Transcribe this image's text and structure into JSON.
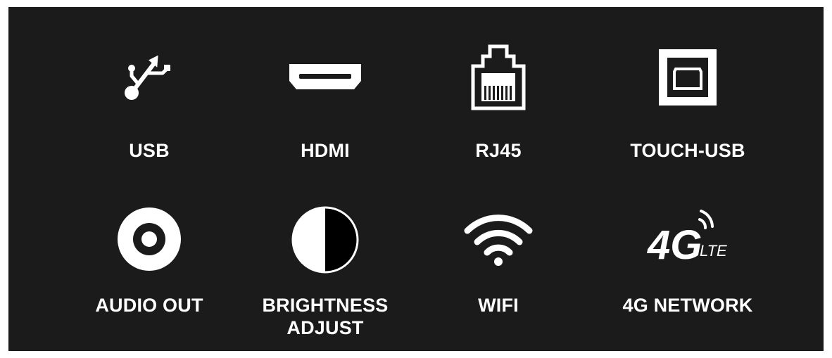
{
  "features": [
    {
      "label": "USB",
      "icon": "usb-icon"
    },
    {
      "label": "HDMI",
      "icon": "hdmi-port-icon"
    },
    {
      "label": "RJ45",
      "icon": "ethernet-port-icon"
    },
    {
      "label": "TOUCH-USB",
      "icon": "usb-b-port-icon"
    },
    {
      "label": "AUDIO OUT",
      "icon": "audio-jack-icon"
    },
    {
      "label": "BRIGHTNESS\nADJUST",
      "icon": "brightness-half-circle-icon"
    },
    {
      "label": "WIFI",
      "icon": "wifi-icon"
    },
    {
      "label": "4G NETWORK",
      "icon": "4g-lte-icon"
    }
  ],
  "icon_text": {
    "lte": "4G LTE"
  },
  "colors": {
    "background": "#1b1b1b",
    "foreground": "#ffffff",
    "page": "#ffffff"
  }
}
